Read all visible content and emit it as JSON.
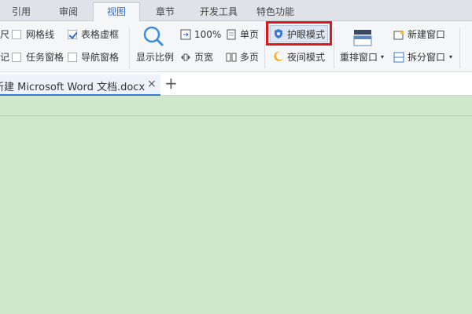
{
  "menu": {
    "tabs": [
      "引用",
      "审阅",
      "视图",
      "章节",
      "开发工具",
      "特色功能"
    ],
    "active": "视图"
  },
  "ribbon": {
    "row1": {
      "ruler": "尺",
      "gridlines": "网格线",
      "table_gridlines": "表格虚框",
      "hundred": "100%",
      "single_page": "单页",
      "eye_mode": "护眼模式",
      "new_window": "新建窗口"
    },
    "row2": {
      "mark": "记",
      "task_pane": "任务窗格",
      "nav_pane": "导航窗格",
      "zoom": "显示比例",
      "page_width": "页宽",
      "multi_page": "多页",
      "night_mode": "夜间模式",
      "rearrange": "重排窗口",
      "split_window": "拆分窗口"
    },
    "checked": {
      "gridlines": false,
      "table_gridlines": true,
      "task_pane": false,
      "nav_pane": false,
      "ruler": false,
      "mark": false
    },
    "colors": {
      "accent": "#2b6bd6",
      "highlight": "#e0151e"
    }
  },
  "document": {
    "tab_title": "新建 Microsoft Word 文档.docx",
    "close": "×",
    "new_tab": "+",
    "page_color": "#cfe8cc"
  }
}
